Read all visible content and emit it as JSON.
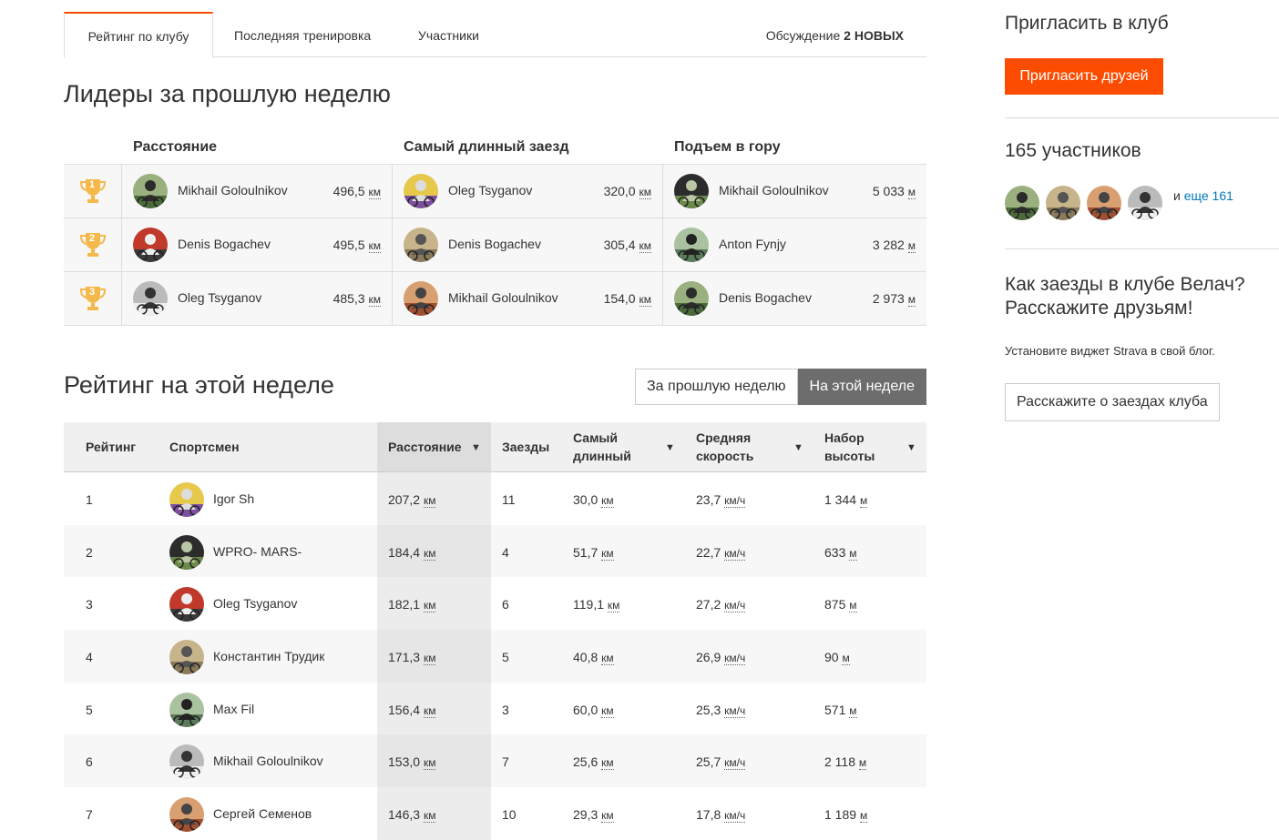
{
  "tabs": {
    "t1": "Рейтинг по клубу",
    "t2": "Последняя тренировка",
    "t3": "Участники",
    "t4_prefix": "Обсуждение",
    "t4_count": "2 НОВЫХ"
  },
  "leaders": {
    "title": "Лидеры за прошлую неделю",
    "col1": "Расстояние",
    "col2": "Самый длинный заезд",
    "col3": "Подъем в гору",
    "rows": [
      {
        "place": "1",
        "d_name": "Mikhail Goloulnikov",
        "d_val": "496,5",
        "d_unit": "км",
        "l_name": "Oleg Tsyganov",
        "l_val": "320,0",
        "l_unit": "км",
        "c_name": "Mikhail Goloulnikov",
        "c_val": "5 033",
        "c_unit": "м"
      },
      {
        "place": "2",
        "d_name": "Denis Bogachev",
        "d_val": "495,5",
        "d_unit": "км",
        "l_name": "Denis Bogachev",
        "l_val": "305,4",
        "l_unit": "км",
        "c_name": "Anton Fynjy",
        "c_val": "3 282",
        "c_unit": "м"
      },
      {
        "place": "3",
        "d_name": "Oleg Tsyganov",
        "d_val": "485,3",
        "d_unit": "км",
        "l_name": "Mikhail Goloulnikov",
        "l_val": "154,0",
        "l_unit": "км",
        "c_name": "Denis Bogachev",
        "c_val": "2 973",
        "c_unit": "м"
      }
    ]
  },
  "ranking": {
    "title": "Рейтинг на этой неделе",
    "toggle_last": "За прошлую неделю",
    "toggle_this": "На этой неделе",
    "headers": {
      "rank": "Рейтинг",
      "athlete": "Спортсмен",
      "distance": "Расстояние",
      "rides": "Заезды",
      "longest_1": "Самый",
      "longest_2": "длинный",
      "speed_1": "Средняя",
      "speed_2": "скорость",
      "elev_1": "Набор",
      "elev_2": "высоты"
    },
    "rows": [
      {
        "rank": "1",
        "name": "Igor Sh",
        "dist": "207,2",
        "rides": "11",
        "longest": "30,0",
        "speed": "23,7",
        "elev": "1 344"
      },
      {
        "rank": "2",
        "name": "WPRO- MARS-",
        "dist": "184,4",
        "rides": "4",
        "longest": "51,7",
        "speed": "22,7",
        "elev": "633"
      },
      {
        "rank": "3",
        "name": "Oleg Tsyganov",
        "dist": "182,1",
        "rides": "6",
        "longest": "119,1",
        "speed": "27,2",
        "elev": "875"
      },
      {
        "rank": "4",
        "name": "Константин Трудик",
        "dist": "171,3",
        "rides": "5",
        "longest": "40,8",
        "speed": "26,9",
        "elev": "90"
      },
      {
        "rank": "5",
        "name": "Max Fil",
        "dist": "156,4",
        "rides": "3",
        "longest": "60,0",
        "speed": "25,3",
        "elev": "571"
      },
      {
        "rank": "6",
        "name": "Mikhail Goloulnikov",
        "dist": "153,0",
        "rides": "7",
        "longest": "25,6",
        "speed": "25,7",
        "elev": "2 118"
      },
      {
        "rank": "7",
        "name": "Сергей Семенов",
        "dist": "146,3",
        "rides": "10",
        "longest": "29,3",
        "speed": "17,8",
        "elev": "1 189"
      }
    ],
    "unit_km": "км",
    "unit_kmh": "км/ч",
    "unit_m": "м"
  },
  "sidebar": {
    "invite_title": "Пригласить в клуб",
    "invite_button": "Пригласить друзей",
    "members_title": "165 участников",
    "members_more_prefix": "и",
    "members_more_link": "еще 161",
    "share_title_1": "Как заезды в клубе Велач?",
    "share_title_2": "Расскажите друзьям!",
    "share_text": "Установите виджет Strava в свой блог.",
    "share_button": "Расскажите о заездах клуба"
  },
  "colors": {
    "accent": "#fc4c02",
    "link": "#0077b3",
    "toggle_active": "#6d6d6d"
  }
}
